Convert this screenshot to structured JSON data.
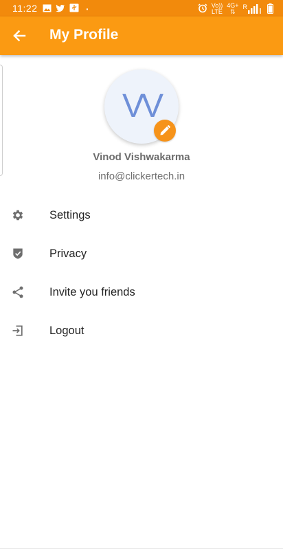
{
  "status_bar": {
    "time": "11:22",
    "dot": "·",
    "network_labels": [
      "Vo))",
      "LTE",
      "4G+",
      "R"
    ],
    "left_icons": [
      "image-icon",
      "twitter-icon",
      "usb-icon"
    ],
    "right_icons": [
      "alarm-icon",
      "signal-icon",
      "battery-icon"
    ]
  },
  "app_bar": {
    "title": "My Profile",
    "back_icon": "arrow-left-icon",
    "color": "#FB9A12"
  },
  "profile": {
    "initials": "VV",
    "name": "Vinod Vishwakarma",
    "email": "info@clickertech.in",
    "edit_icon": "pencil-icon",
    "accent": "#F6931A"
  },
  "menu": {
    "items": [
      {
        "label": "Settings",
        "icon": "gear-icon"
      },
      {
        "label": "Privacy",
        "icon": "shield-check-icon"
      },
      {
        "label": "Invite you friends",
        "icon": "share-icon"
      },
      {
        "label": "Logout",
        "icon": "logout-icon"
      }
    ]
  }
}
